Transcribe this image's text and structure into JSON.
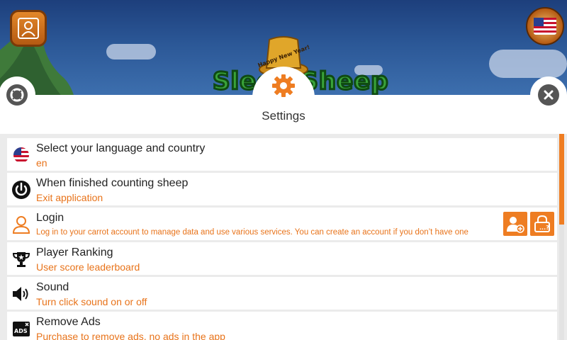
{
  "header": {
    "profile_button_icon": "user-icon",
    "language_flag_icon": "us-flag-icon",
    "game_title": "Sleep Sheep",
    "hat_text": "Happy New Year!"
  },
  "panel": {
    "title": "Settings",
    "gear_icon": "gear-icon",
    "left_button_icon": "lifebuoy-icon",
    "close_button_icon": "close-icon"
  },
  "settings": [
    {
      "title": "Select your language and country",
      "subtitle": "en",
      "icon": "us-flag-icon"
    },
    {
      "title": "When finished counting sheep",
      "subtitle": "Exit application",
      "icon": "power-icon"
    },
    {
      "title": "Login",
      "subtitle": "Log in to your carrot account to manage data and use various services. You can create an account if you don’t have one",
      "icon": "user-outline-icon"
    },
    {
      "title": "Player Ranking",
      "subtitle": "User score leaderboard",
      "icon": "trophy-icon"
    },
    {
      "title": "Sound",
      "subtitle": "Turn click sound on or off",
      "icon": "speaker-icon"
    },
    {
      "title": "Remove Ads",
      "subtitle": "Purchase to remove ads, no ads in the app",
      "icon": "remove-ads-icon"
    }
  ],
  "colors": {
    "accent": "#ee7d22",
    "subtitle": "#e8731a",
    "list_bg": "#ebebeb"
  }
}
